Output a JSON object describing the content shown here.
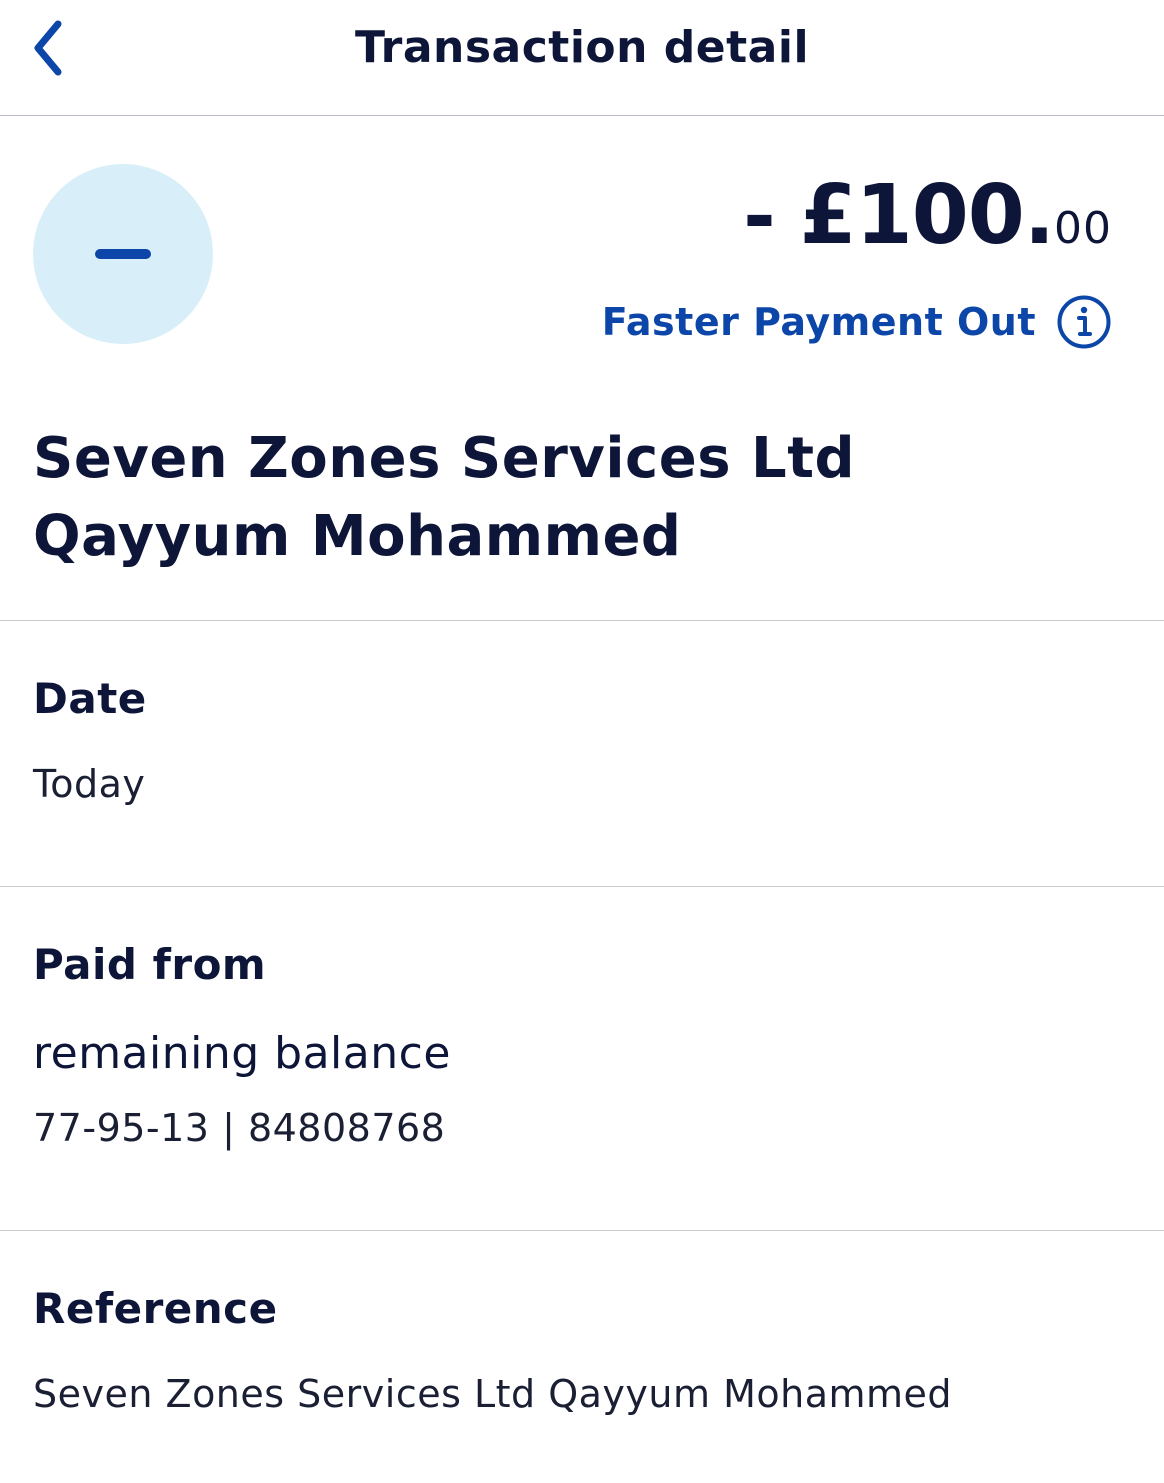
{
  "header": {
    "title": "Transaction detail",
    "back_icon": "chevron-left-icon"
  },
  "transaction": {
    "sign": "-",
    "amount_main": "£100.",
    "amount_pence": "00",
    "type": "Faster Payment Out",
    "type_icon": "info-icon",
    "direction_icon": "minus-icon",
    "payee_line1": "Seven Zones Services Ltd",
    "payee_line2": "Qayyum Mohammed"
  },
  "details": {
    "date": {
      "label": "Date",
      "value": "Today"
    },
    "paid_from": {
      "label": "Paid from",
      "account_name": "remaining balance",
      "account_details": "77-95-13 | 84808768"
    },
    "reference": {
      "label": "Reference",
      "value": "Seven Zones Services Ltd Qayyum Mohammed"
    }
  },
  "colors": {
    "accent": "#0b46a8",
    "text": "#0d1538",
    "avatar_bg": "#d8eef8",
    "divider": "#c8cacf"
  }
}
